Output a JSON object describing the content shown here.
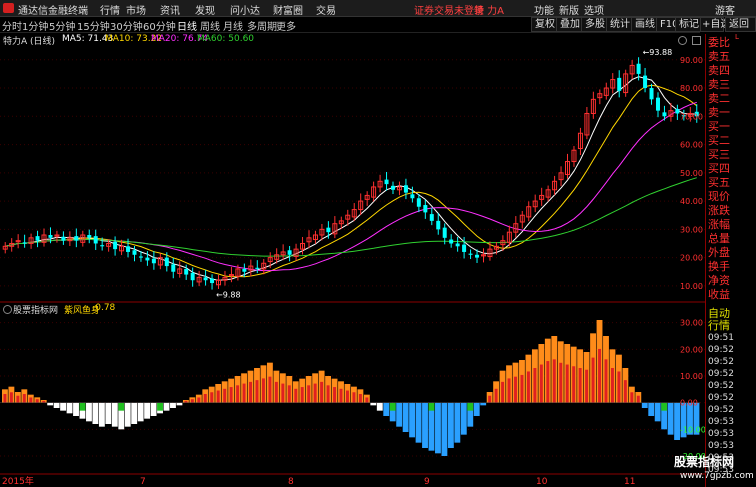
{
  "app": {
    "title": "通达信金融终端"
  },
  "menu": [
    "行情",
    "市场",
    "资讯",
    "发现",
    "问小达",
    "财富圈",
    "交易"
  ],
  "warning": "证券交易未登录",
  "stock_name_top": "特 力A",
  "right_menu": [
    "功能",
    "新版",
    "选项",
    "游客"
  ],
  "periods": [
    "分时",
    "1分钟",
    "5分钟",
    "15分钟",
    "30分钟",
    "60分钟",
    "日线",
    "周线",
    "月线",
    "多周期",
    "更多"
  ],
  "active_period": "日线",
  "right_tools": [
    "复权",
    "叠加",
    "多股",
    "统计",
    "画线",
    "F10",
    "标记",
    "+自选",
    "返回"
  ],
  "legend": {
    "name": "特力A (日线)",
    "ma5": "MA5: 71.43",
    "ma10": "MA10: 73.22",
    "ma20": "MA20: 76.74",
    "ma60": "MA60: 50.60"
  },
  "colors": {
    "ma5": "#ffffff",
    "ma10": "#ffd700",
    "ma20": "#ff30ff",
    "ma60": "#30d030",
    "up": "#ff3030",
    "down": "#00ffff"
  },
  "right_panel_top": [
    {
      "t": "委比",
      "c": "red"
    },
    {
      "t": "卖五",
      "c": "red"
    },
    {
      "t": "卖四",
      "c": "red"
    },
    {
      "t": "卖三",
      "c": "red"
    },
    {
      "t": "卖二",
      "c": "red"
    },
    {
      "t": "卖一",
      "c": "red"
    },
    {
      "t": "买一",
      "c": "red"
    },
    {
      "t": "买二",
      "c": "red"
    },
    {
      "t": "买三",
      "c": "red"
    },
    {
      "t": "买四",
      "c": "red"
    },
    {
      "t": "买五",
      "c": "red"
    },
    {
      "t": "现价",
      "c": "red"
    },
    {
      "t": "涨跌",
      "c": "red"
    },
    {
      "t": "涨幅",
      "c": "red"
    },
    {
      "t": "总量",
      "c": "red"
    },
    {
      "t": "外盘",
      "c": "red"
    },
    {
      "t": "换手",
      "c": "red"
    },
    {
      "t": "净资",
      "c": "red"
    },
    {
      "t": "收益",
      "c": "red"
    }
  ],
  "right_panel_bottom": [
    "自动",
    "行情",
    "09:51",
    "09:52",
    "09:52",
    "09:52",
    "09:52",
    "09:52",
    "09:52",
    "09:53",
    "09:53",
    "09:53",
    "09:53",
    "09:53"
  ],
  "sub": {
    "name": "股票指标网",
    "indicator": "紫风鱼身",
    "value": "-0.78"
  },
  "x_labels": [
    "2015年",
    "7",
    "8",
    "9",
    "10",
    "11"
  ],
  "watermark": {
    "main": "股票指标网",
    "sub": "www.7gpzb.com"
  },
  "chart_data": [
    {
      "type": "candlestick",
      "y_ticks": [
        10,
        20,
        30,
        40,
        50,
        60,
        70,
        80,
        90
      ],
      "ylim": [
        5,
        97
      ],
      "annotations": [
        {
          "text": "93.88",
          "kind": "high"
        },
        {
          "text": "9.88",
          "kind": "low"
        }
      ],
      "ma_latest": {
        "MA5": 71.43,
        "MA10": 73.22,
        "MA20": 76.74,
        "MA60": 50.6
      },
      "closes": [
        24,
        25,
        26,
        25,
        27,
        26,
        28,
        27,
        28,
        26,
        27,
        26,
        28,
        27,
        25,
        24,
        25,
        23,
        24,
        22,
        21,
        20,
        19,
        18,
        20,
        17,
        15,
        16,
        14,
        12,
        13,
        12,
        11,
        12,
        13,
        14,
        16,
        15,
        17,
        16,
        18,
        20,
        21,
        22,
        21,
        23,
        25,
        27,
        28,
        30,
        29,
        32,
        33,
        35,
        37,
        40,
        42,
        45,
        47,
        46,
        44,
        45,
        43,
        41,
        38,
        36,
        33,
        30,
        27,
        25,
        24,
        22,
        21,
        20,
        21,
        23,
        24,
        26,
        29,
        32,
        35,
        38,
        40,
        42,
        44,
        47,
        50,
        54,
        58,
        64,
        71,
        76,
        78,
        80,
        83,
        79,
        85,
        88,
        85,
        80,
        76,
        72,
        70,
        72,
        71,
        70,
        71,
        70
      ]
    },
    {
      "type": "bar",
      "indicator": "紫风鱼身",
      "y_ticks": [
        30,
        20,
        10,
        0,
        -10,
        -20
      ],
      "ylim": [
        -26,
        34
      ],
      "latest": -0.78,
      "values": [
        5,
        6,
        4,
        5,
        3,
        2,
        1,
        -1,
        -2,
        -3,
        -4,
        -5,
        -6,
        -7,
        -8,
        -9,
        -8,
        -9,
        -10,
        -9,
        -8,
        -7,
        -6,
        -5,
        -4,
        -3,
        -2,
        -1,
        1,
        2,
        3,
        5,
        6,
        7,
        8,
        9,
        10,
        11,
        12,
        13,
        14,
        15,
        12,
        11,
        10,
        8,
        9,
        10,
        11,
        12,
        10,
        9,
        8,
        7,
        6,
        5,
        3,
        -1,
        -3,
        -5,
        -7,
        -9,
        -11,
        -13,
        -15,
        -17,
        -18,
        -19,
        -20,
        -17,
        -15,
        -12,
        -9,
        -5,
        -1,
        4,
        8,
        12,
        14,
        15,
        16,
        18,
        20,
        22,
        24,
        25,
        23,
        22,
        21,
        20,
        19,
        26,
        31,
        25,
        20,
        18,
        13,
        6,
        4,
        -2,
        -5,
        -7,
        -10,
        -12,
        -14,
        -13,
        -12,
        -12
      ]
    }
  ]
}
